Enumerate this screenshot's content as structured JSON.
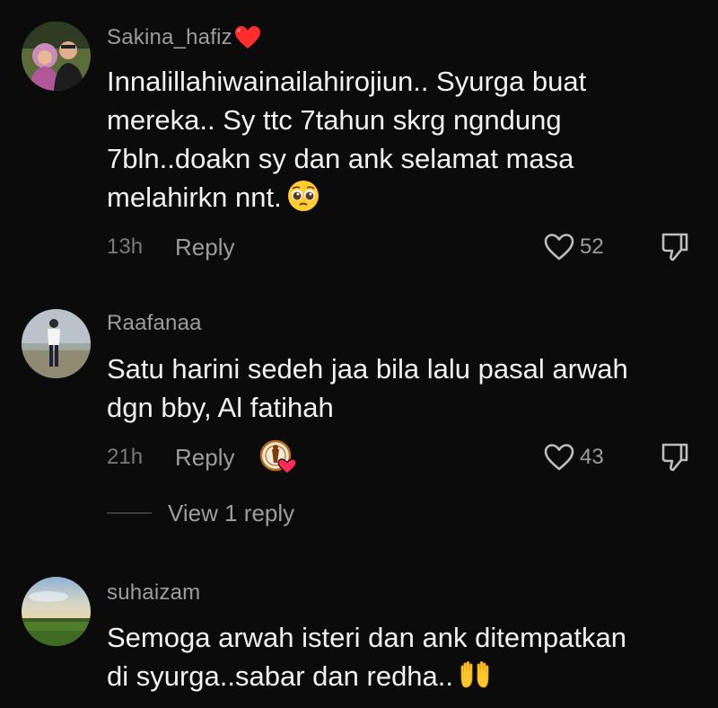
{
  "comments": [
    {
      "username": "Sakina_hafiz",
      "username_emoji": "red-heart",
      "lines": [
        "Innalillahiwainailahirojiun.. Syurga buat",
        "mereka.. Sy ttc 7tahun skrg ngndung",
        "7bln..doakn sy dan ank selamat masa",
        "melahirkn nnt."
      ],
      "trailing_emoji": "pleading-face",
      "time": "13h",
      "reply_label": "Reply",
      "likes": "52"
    },
    {
      "username": "Raafanaa",
      "lines": [
        "Satu harini sedeh jaa bila lalu pasal arwah",
        "dgn bby, Al fatihah"
      ],
      "time": "21h",
      "reply_label": "Reply",
      "creator_liked": true,
      "likes": "43",
      "view_replies_label": "View 1 reply"
    },
    {
      "username": "suhaizam",
      "lines": [
        "Semoga arwah isteri dan ank ditempatkan",
        "di syurga..sabar dan redha.."
      ],
      "trailing_emoji": "raising-hands"
    }
  ],
  "colors": {
    "background": "#0b0b0b",
    "text": "#f2f2f2",
    "muted": "#9d9d9d",
    "heart_red": "#fe2c55"
  }
}
